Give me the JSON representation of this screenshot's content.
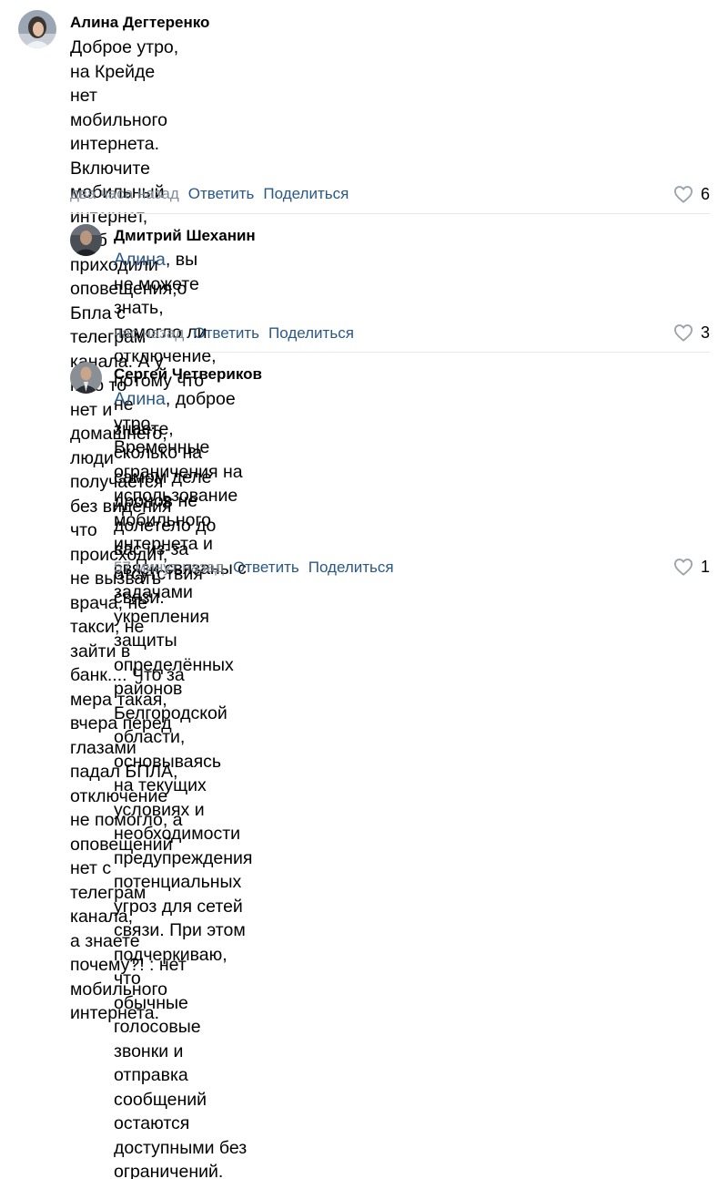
{
  "comments": [
    {
      "author": "Алина Дегтеренко",
      "mention": "",
      "lines": [
        "Доброе утро, на Крейде нет мобильного интернета. Включите мобильный",
        "интернет, чтоб приходили оповещения,о Бпла с телеграм канала. А у кого то",
        "нет и домашнего, люди получается без видения что происходит, не вызвать",
        "врача, не такси, не зайти в банк.... Что за мера такая, вчера перед глазами",
        "падал БПЛА, отключение не помогло, а оповещений нет с телеграм канала,",
        "а знаете почему?! : нет мобильного интернета."
      ],
      "time": "два часа назад",
      "reply_label": "Ответить",
      "share_label": "Поделиться",
      "likes": "6"
    },
    {
      "author": "Дмитрий Шеханин",
      "mention": "Алина",
      "lines": [
        ", вы не можете знать, помогло ли отключение, потому что не",
        "знаете, сколько на самом деле дронов не долетело до вас из-за",
        "отсутствия связи."
      ],
      "time": "час назад",
      "reply_label": "Ответить",
      "share_label": "Поделиться",
      "likes": "3"
    },
    {
      "author": "Сергей Четвериков",
      "mention": "Алина",
      "lines": [
        ", доброе утро. Временные ограничения на использование",
        "мобильного интернета и связи связаны с задачами укрепления",
        "защиты определённых районов Белгородской области, основываясь",
        "на текущих условиях и необходимости предупреждения",
        "потенциальных угроз для сетей связи. При этом подчеркиваю, что",
        "обычные голосовые звонки и отправка сообщений остаются",
        "доступными без ограничений."
      ],
      "time": "57 минут назад",
      "reply_label": "Ответить",
      "share_label": "Поделиться",
      "likes": "1"
    }
  ],
  "colors": {
    "link": "#2a5885",
    "meta": "#818c99",
    "divider": "#e7e8ec",
    "heart": "#99a2ad"
  }
}
